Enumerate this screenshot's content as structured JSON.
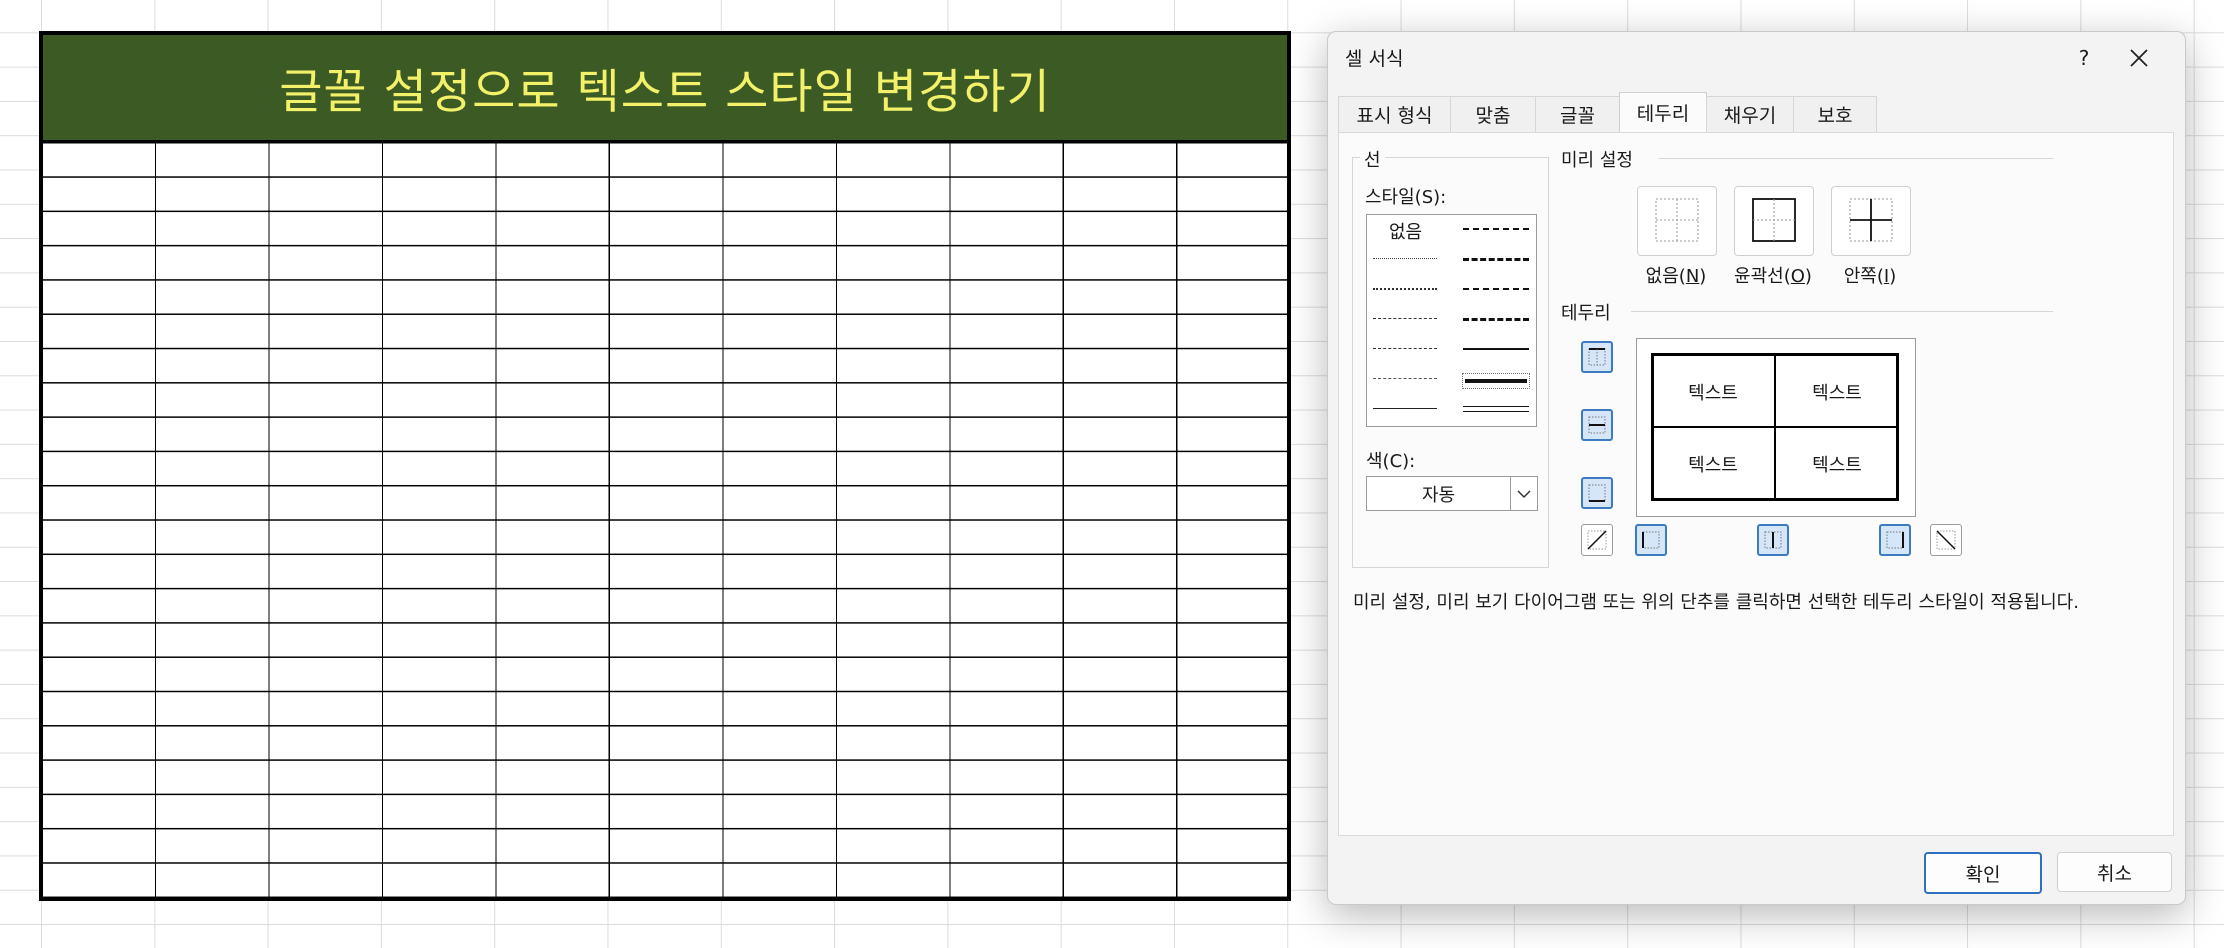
{
  "sheet": {
    "title": "글꼴 설정으로 텍스트 스타일 변경하기",
    "title_bg_color": "#3b5a24",
    "title_text_color": "#f3f06a"
  },
  "dialog": {
    "title": "셀 서식",
    "help_label": "?",
    "close_label": "✕",
    "tabs": [
      {
        "label": "표시 형식",
        "active": false
      },
      {
        "label": "맞춤",
        "active": false
      },
      {
        "label": "글꼴",
        "active": false
      },
      {
        "label": "테두리",
        "active": true
      },
      {
        "label": "채우기",
        "active": false
      },
      {
        "label": "보호",
        "active": false
      }
    ],
    "line_group": {
      "label": "선",
      "style_label": "스타일(S):",
      "style_none": "없음",
      "color_label": "색(C):",
      "color_value": "자동",
      "color_dropdown_icon": "chevron-down-icon"
    },
    "presets": {
      "label": "미리 설정",
      "items": [
        {
          "label": "없음(N)",
          "icon": "border-none-icon"
        },
        {
          "label": "윤곽선(O)",
          "icon": "border-outline-icon"
        },
        {
          "label": "안쪽(I)",
          "icon": "border-inside-icon"
        }
      ]
    },
    "border": {
      "label": "테두리",
      "preview_cells": [
        "텍스트",
        "텍스트",
        "텍스트",
        "텍스트"
      ]
    },
    "note": "미리 설정, 미리 보기 다이어그램 또는 위의 단추를 클릭하면 선택한 테두리 스타일이 적용됩니다.",
    "ok_label": "확인",
    "cancel_label": "취소"
  }
}
